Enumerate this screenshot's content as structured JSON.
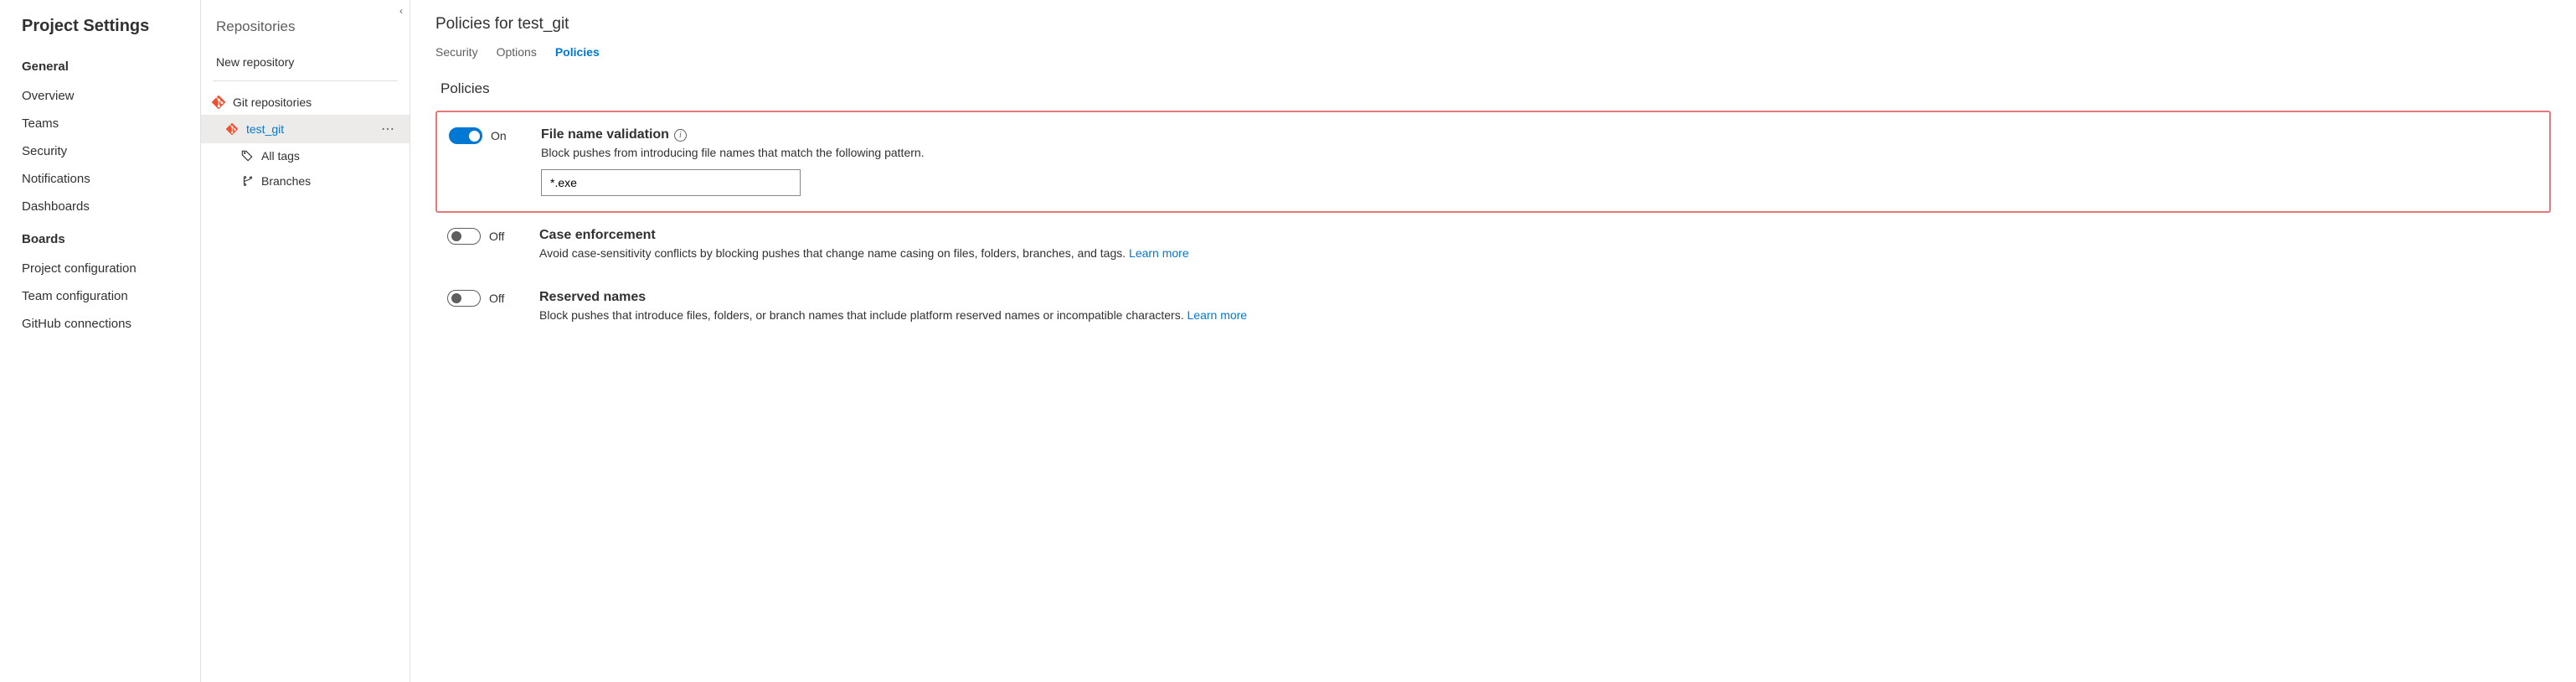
{
  "left": {
    "title": "Project Settings",
    "groups": [
      {
        "label": "General",
        "items": [
          "Overview",
          "Teams",
          "Security",
          "Notifications",
          "Dashboards"
        ]
      },
      {
        "label": "Boards",
        "items": [
          "Project configuration",
          "Team configuration",
          "GitHub connections"
        ]
      }
    ]
  },
  "mid": {
    "title": "Repositories",
    "new_action": "New repository",
    "root": {
      "label": "Git repositories"
    },
    "repo": {
      "label": "test_git"
    },
    "tags": {
      "label": "All tags"
    },
    "branches": {
      "label": "Branches"
    }
  },
  "main": {
    "title": "Policies for test_git",
    "tabs": {
      "security": "Security",
      "options": "Options",
      "policies": "Policies"
    },
    "section": "Policies",
    "learn_more": "Learn more",
    "policies": {
      "file_name": {
        "state": "On",
        "name": "File name validation",
        "desc": "Block pushes from introducing file names that match the following pattern.",
        "value": "*.exe"
      },
      "case": {
        "state": "Off",
        "name": "Case enforcement",
        "desc": "Avoid case-sensitivity conflicts by blocking pushes that change name casing on files, folders, branches, and tags. "
      },
      "reserved": {
        "state": "Off",
        "name": "Reserved names",
        "desc": "Block pushes that introduce files, folders, or branch names that include platform reserved names or incompatible characters. "
      }
    }
  }
}
